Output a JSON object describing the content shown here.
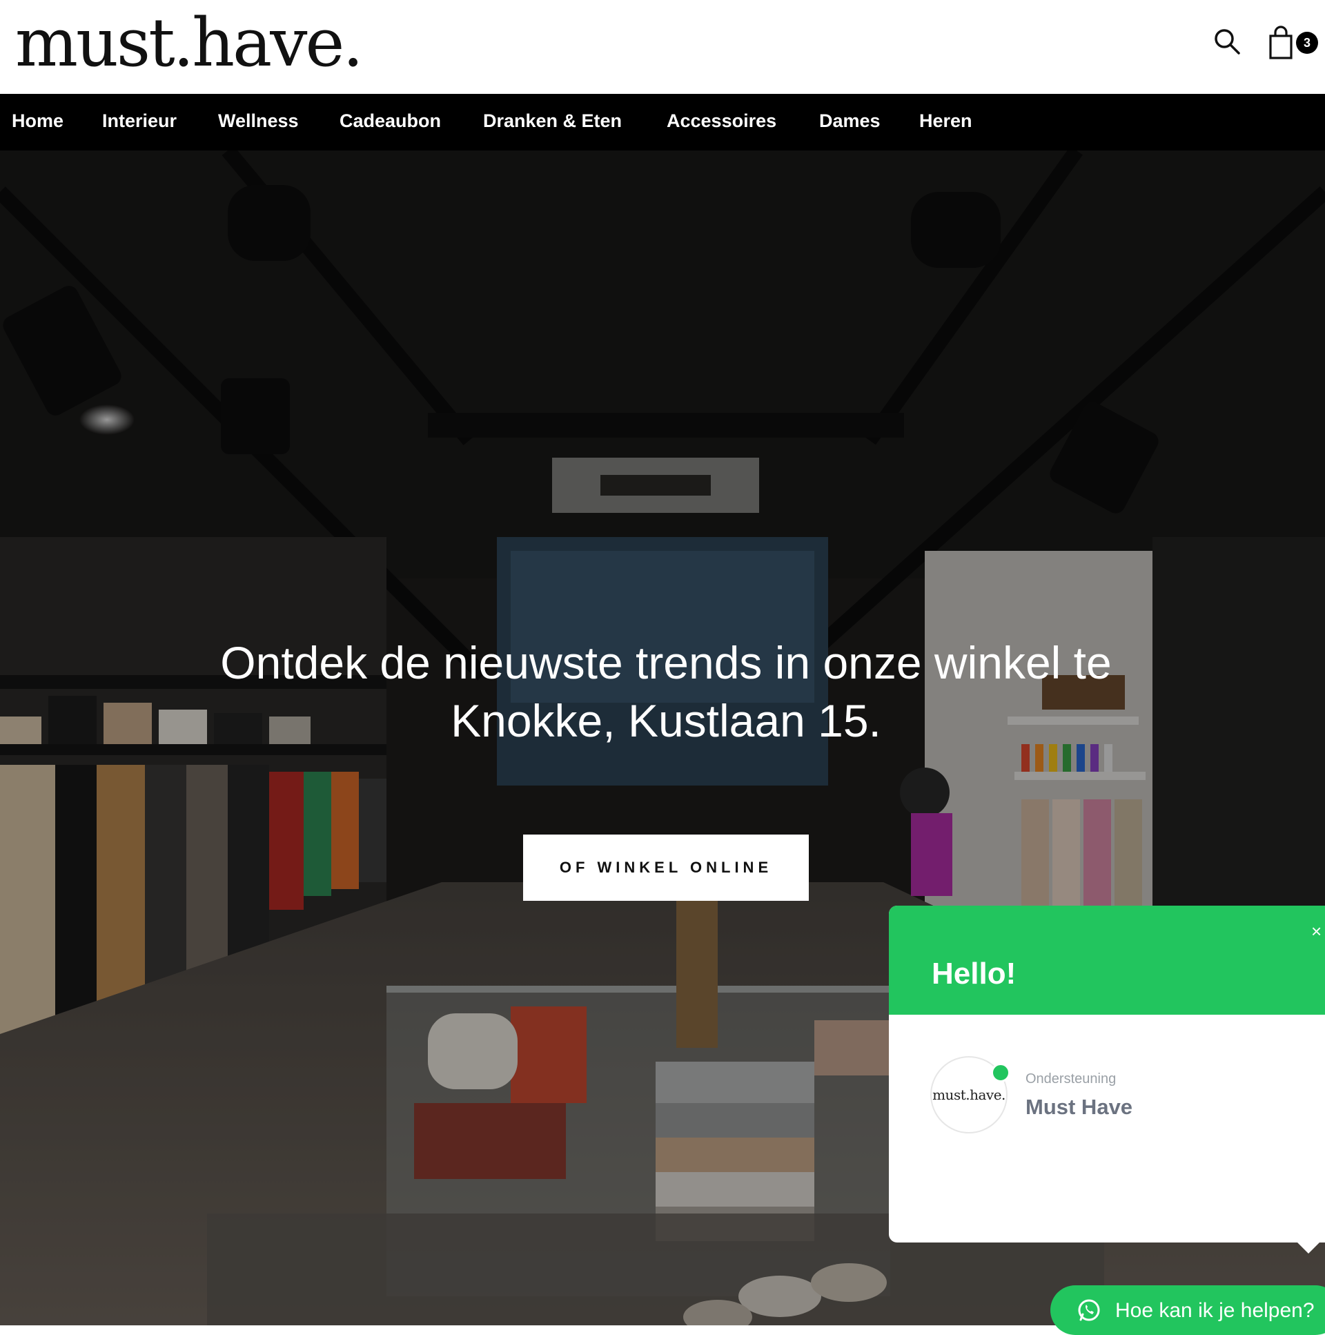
{
  "header": {
    "logo": "must.have.",
    "search_icon": "search-icon",
    "cart_icon": "shopping-bag-icon",
    "cart_count": "3"
  },
  "nav": {
    "items": [
      "Home",
      "Interieur",
      "Wellness",
      "Cadeaubon",
      "Dranken & Eten",
      "Accessoires",
      "Dames",
      "Heren"
    ]
  },
  "hero": {
    "title": "Ontdek de nieuwste trends in onze winkel te Knokke, Kustlaan 15.",
    "cta": "OF WINKEL ONLINE"
  },
  "chat": {
    "hello": "Hello!",
    "close": "×",
    "avatar_logo": "must.have.",
    "subtitle": "Ondersteuning",
    "agent_name": "Must Have",
    "launcher": "Hoe kan ik je helpen?",
    "whatsapp_icon": "whatsapp-icon"
  },
  "colors": {
    "nav_bg": "#000000",
    "chat_green": "#22c55e",
    "hero_overlay": "#1e1c1b"
  }
}
